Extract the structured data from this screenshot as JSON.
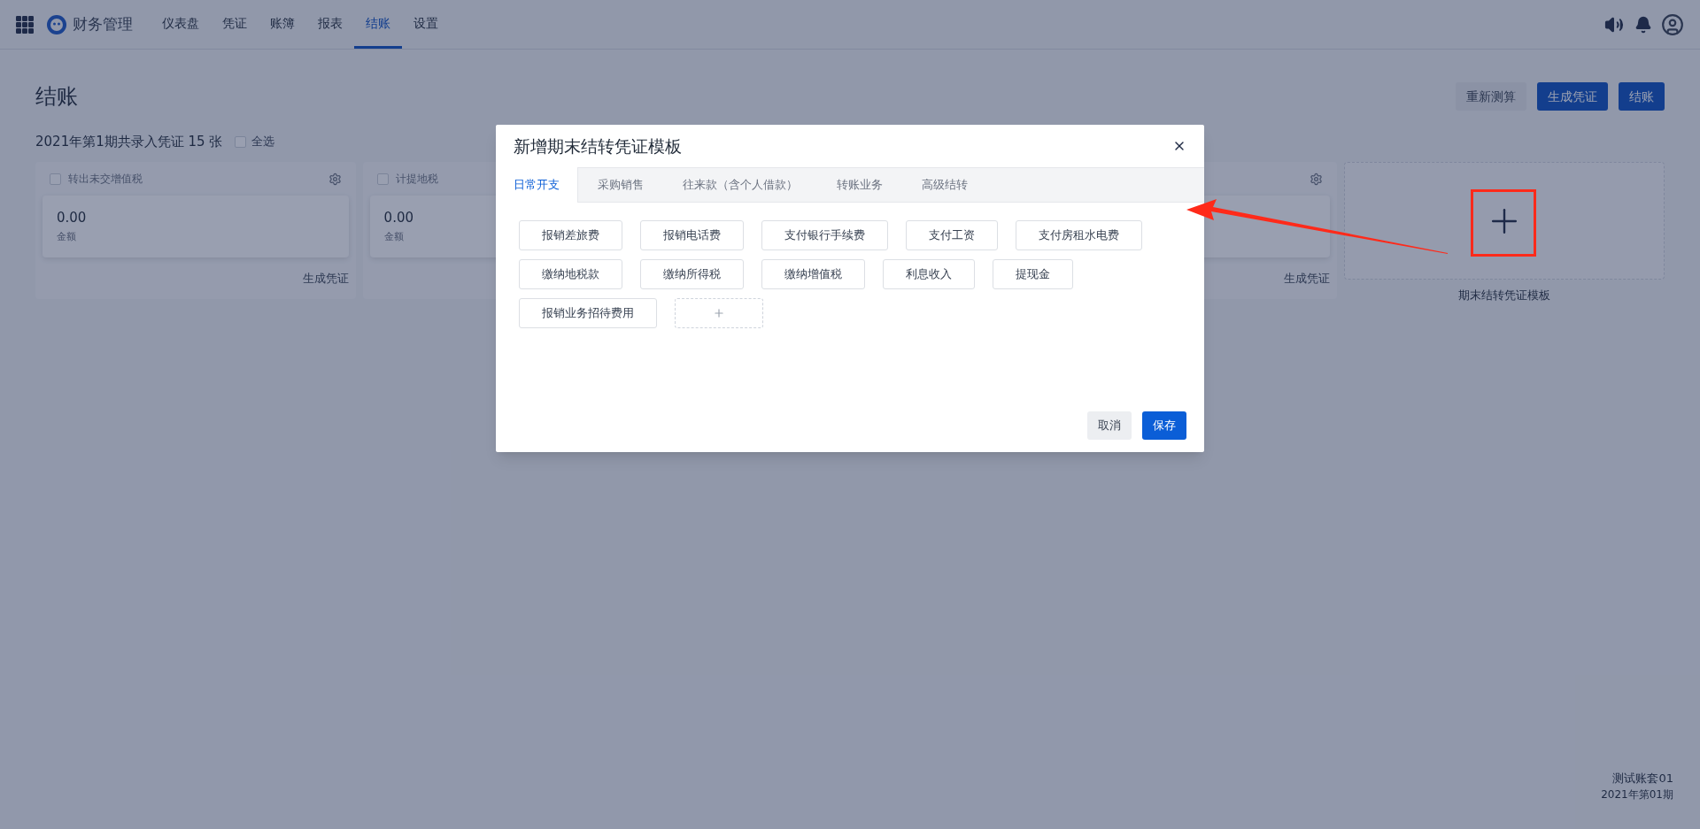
{
  "app": {
    "title": "财务管理"
  },
  "nav": [
    {
      "label": "仪表盘",
      "selected": false
    },
    {
      "label": "凭证",
      "selected": false
    },
    {
      "label": "账簿",
      "selected": false
    },
    {
      "label": "报表",
      "selected": false
    },
    {
      "label": "结账",
      "selected": true
    },
    {
      "label": "设置",
      "selected": false
    }
  ],
  "page": {
    "title": "结账",
    "actions": [
      {
        "label": "重新测算",
        "kind": "secondary"
      },
      {
        "label": "生成凭证",
        "kind": "primary"
      },
      {
        "label": "结账",
        "kind": "primary"
      }
    ],
    "summary": "2021年第1期共录入凭证 15 张",
    "select_all": {
      "label": "全选",
      "checked": false
    },
    "cards": [
      {
        "title": "转出未交增值税",
        "checked": false,
        "amount": "0.00",
        "amount_label": "金额",
        "action": "生成凭证"
      },
      {
        "title": "计提地税",
        "checked": false,
        "amount": "0.00",
        "amount_label": "金额"
      },
      {
        "action": "生成凭证"
      }
    ],
    "add_card": {
      "label": "期末结转凭证模板"
    }
  },
  "footer": {
    "account": "测试账套01",
    "period": "2021年第01期"
  },
  "dialog": {
    "title": "新增期末结转凭证模板",
    "tabs": [
      {
        "label": "日常开支",
        "selected": true
      },
      {
        "label": "采购销售",
        "selected": false
      },
      {
        "label": "往来款（含个人借款）",
        "selected": false
      },
      {
        "label": "转账业务",
        "selected": false
      },
      {
        "label": "高级结转",
        "selected": false
      }
    ],
    "templates": [
      "报销差旅费",
      "报销电话费",
      "支付银行手续费",
      "支付工资",
      "支付房租水电费",
      "缴纳地税款",
      "缴纳所得税",
      "缴纳增值税",
      "利息收入",
      "提现金",
      "报销业务招待费用"
    ],
    "buttons": [
      {
        "label": "取消",
        "kind": "secondary"
      },
      {
        "label": "保存",
        "kind": "primary"
      }
    ]
  }
}
